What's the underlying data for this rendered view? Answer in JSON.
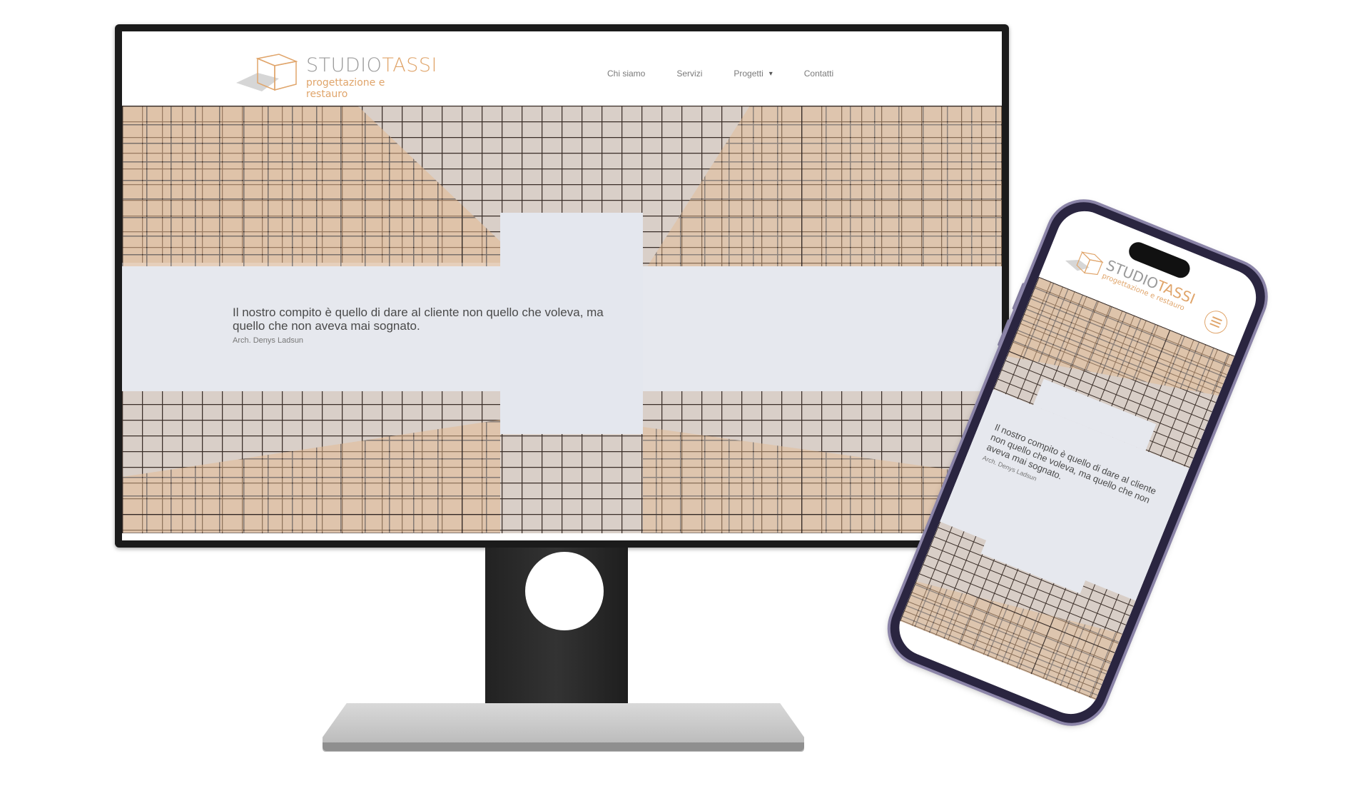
{
  "site": {
    "brand_main": "STUDIO",
    "brand_accent": "TASSI",
    "tagline": "progettazione e restauro",
    "nav": [
      {
        "label": "Chi siamo"
      },
      {
        "label": "Servizi"
      },
      {
        "label": "Progetti",
        "has_dropdown": true
      },
      {
        "label": "Contatti"
      }
    ],
    "quote": {
      "text": "Il nostro compito è quello di dare al cliente non quello che voleva, ma quello che non aveva mai sognato.",
      "author": "Arch. Denys Ladsun"
    },
    "colors": {
      "accent": "#e0a56b",
      "brand_gray": "#9a9a9a",
      "text": "#4a4a4a"
    }
  },
  "icons": {
    "logo": "cube-logo-icon",
    "dropdown": "chevron-down-icon",
    "mobile_menu": "hamburger-menu-icon"
  }
}
